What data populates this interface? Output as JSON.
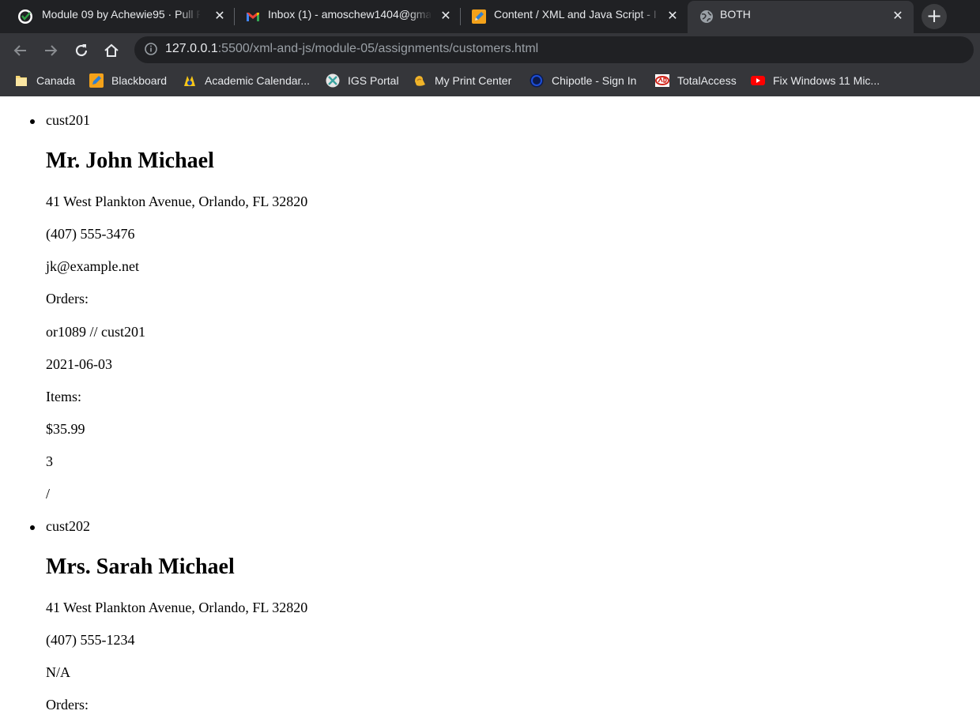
{
  "browser": {
    "tabs": [
      {
        "title": "Module 09 by Achewie95 · Pull Re",
        "icon": "github-icon"
      },
      {
        "title": "Inbox (1) - amoschew1404@gmai",
        "icon": "gmail-icon"
      },
      {
        "title": "Content / XML and Java Script - I",
        "icon": "pencil-icon"
      },
      {
        "title": "BOTH",
        "icon": "globe-icon"
      }
    ],
    "new_tab_symbol": "+",
    "url_host": "127.0.0.1",
    "url_rest": ":5500/xml-and-js/module-05/assignments/customers.html",
    "bookmarks": [
      {
        "label": "Canada",
        "icon": "folder-icon"
      },
      {
        "label": "Blackboard",
        "icon": "blackboard-icon"
      },
      {
        "label": "Academic Calendar...",
        "icon": "calendar-site-icon"
      },
      {
        "label": "IGS Portal",
        "icon": "igs-icon"
      },
      {
        "label": "My Print Center",
        "icon": "print-center-icon"
      },
      {
        "label": "Chipotle - Sign In",
        "icon": "chipotle-icon"
      },
      {
        "label": "TotalAccess",
        "icon": "adp-icon"
      },
      {
        "label": "Fix Windows 11 Mic...",
        "icon": "youtube-icon"
      }
    ],
    "colors": {
      "tabstrip_bg": "#202124",
      "toolbar_bg": "#35363a",
      "omnibox_bg": "#202124",
      "text": "#e8eaed",
      "url_dim": "#9aa0a6"
    }
  },
  "customers": [
    {
      "id": "cust201",
      "name": "Mr. John Michael",
      "address": "41 West Plankton Avenue, Orlando, FL 32820",
      "phone": "(407) 555-3476",
      "email": "jk@example.net",
      "orders_label": "Orders:",
      "order_ref": "or1089 // cust201",
      "order_date": "2021-06-03",
      "items_label": "Items:",
      "price": "$35.99",
      "qty": "3",
      "slash": "/"
    },
    {
      "id": "cust202",
      "name": "Mrs. Sarah Michael",
      "address": "41 West Plankton Avenue, Orlando, FL 32820",
      "phone": "(407) 555-1234",
      "email": "N/A",
      "orders_label": "Orders:"
    }
  ]
}
